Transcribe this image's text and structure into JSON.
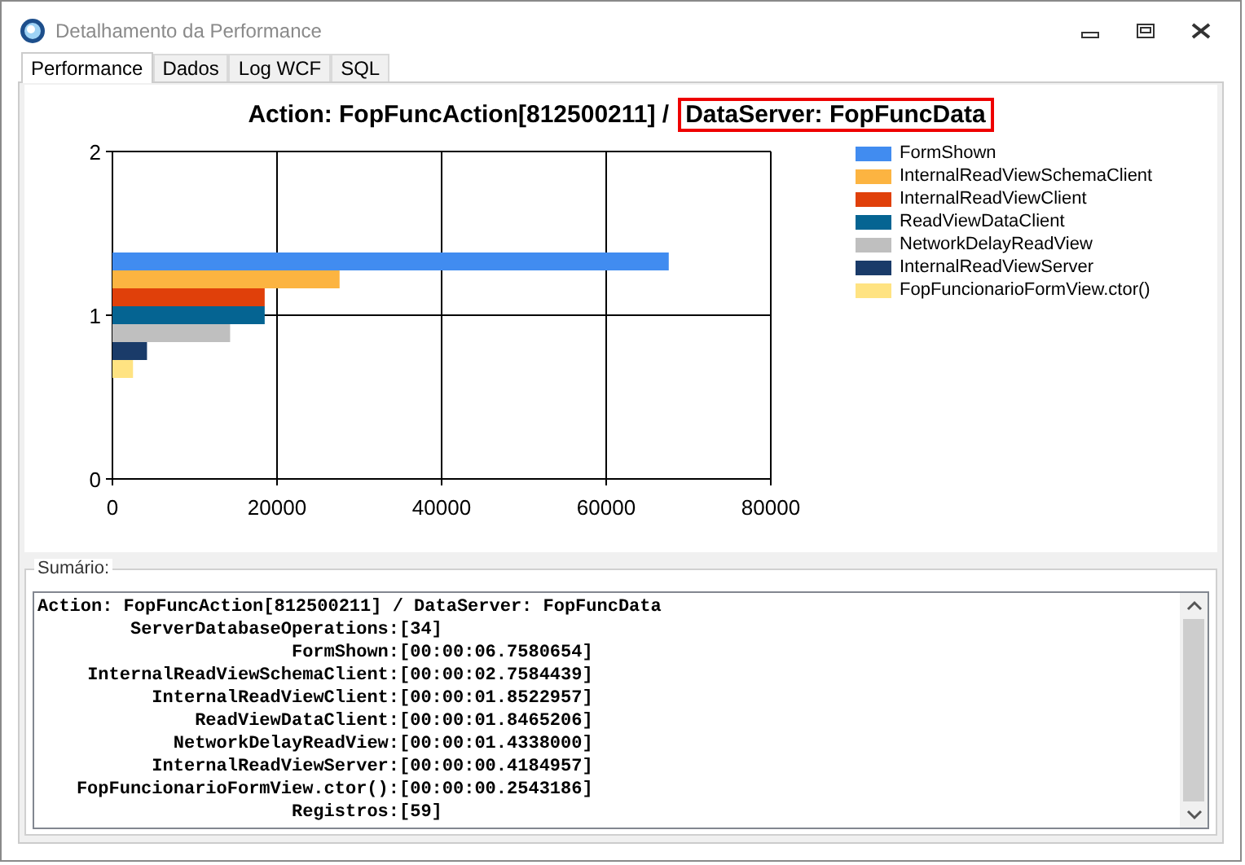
{
  "window": {
    "title": "Detalhamento da Performance"
  },
  "tabs": [
    {
      "label": "Performance",
      "selected": true
    },
    {
      "label": "Dados",
      "selected": false
    },
    {
      "label": "Log WCF",
      "selected": false
    },
    {
      "label": "SQL",
      "selected": false
    }
  ],
  "chart": {
    "title": "Action: FopFuncAction[812500211] /",
    "title_highlight": "DataServer: FopFuncData",
    "chart_data": {
      "type": "bar",
      "orientation": "horizontal",
      "grid": true,
      "categories": [
        "2",
        "1",
        "0"
      ],
      "xlim": [
        0,
        80000
      ],
      "xticks": [
        0,
        20000,
        40000,
        60000,
        80000
      ],
      "series": [
        {
          "name": "FormShown",
          "color": "#418cf0",
          "values": [
            null,
            67600,
            null
          ]
        },
        {
          "name": "InternalReadViewSchemaClient",
          "color": "#fcb441",
          "values": [
            null,
            27600,
            null
          ]
        },
        {
          "name": "InternalReadViewClient",
          "color": "#e0400a",
          "values": [
            null,
            18500,
            null
          ]
        },
        {
          "name": "ReadViewDataClient",
          "color": "#056492",
          "values": [
            null,
            18500,
            null
          ]
        },
        {
          "name": "NetworkDelayReadView",
          "color": "#bfbfbf",
          "values": [
            null,
            14300,
            null
          ]
        },
        {
          "name": "InternalReadViewServer",
          "color": "#1a3b69",
          "values": [
            null,
            4200,
            null
          ]
        },
        {
          "name": "FopFuncionarioFormView.ctor()",
          "color": "#ffe382",
          "values": [
            null,
            2500,
            null
          ]
        }
      ]
    }
  },
  "summary": {
    "label": "Sumário:",
    "header": "Action: FopFuncAction[812500211] / DataServer: FopFuncData",
    "lines": [
      {
        "label": "ServerDatabaseOperations:",
        "value": "[34]"
      },
      {
        "label": "FormShown:",
        "value": "[00:00:06.7580654]"
      },
      {
        "label": "InternalReadViewSchemaClient:",
        "value": "[00:00:02.7584439]"
      },
      {
        "label": "InternalReadViewClient:",
        "value": "[00:00:01.8522957]"
      },
      {
        "label": "ReadViewDataClient:",
        "value": "[00:00:01.8465206]"
      },
      {
        "label": "NetworkDelayReadView:",
        "value": "[00:00:01.4338000]"
      },
      {
        "label": "InternalReadViewServer:",
        "value": "[00:00:00.4184957]"
      },
      {
        "label": "FopFuncionarioFormView.ctor():",
        "value": "[00:00:00.2543186]"
      },
      {
        "label": "Registros:",
        "value": "[59]"
      }
    ]
  }
}
